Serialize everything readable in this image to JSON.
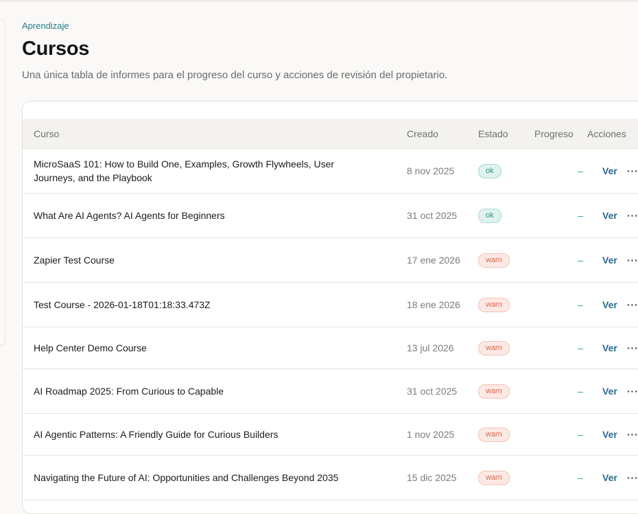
{
  "breadcrumb": "Aprendizaje",
  "page": {
    "title": "Cursos",
    "subtitle": "Una única tabla de informes para el progreso del curso y acciones de revisión del propietario."
  },
  "table": {
    "headers": {
      "curso": "Curso",
      "creado": "Creado",
      "estado": "Estado",
      "progreso": "Progreso",
      "acciones": "Acciones"
    },
    "rows": [
      {
        "title": "MicroSaaS 101: How to Build One, Examples, Growth Flywheels, User Journeys, and the Playbook",
        "created": "8 nov 2025",
        "status": "ok",
        "progress": "–",
        "action": "Ver",
        "more": "···"
      },
      {
        "title": "What Are AI Agents? AI Agents for Beginners",
        "created": "31 oct 2025",
        "status": "ok",
        "progress": "–",
        "action": "Ver",
        "more": "···"
      },
      {
        "title": "Zapier Test Course",
        "created": "17 ene 2026",
        "status": "warn",
        "progress": "–",
        "action": "Ver",
        "more": "···"
      },
      {
        "title": "Test Course - 2026-01-18T01:18:33.473Z",
        "created": "18 ene 2026",
        "status": "warn",
        "progress": "–",
        "action": "Ver",
        "more": "···"
      },
      {
        "title": "Help Center Demo Course",
        "created": "13 jul 2026",
        "status": "warn",
        "progress": "–",
        "action": "Ver",
        "more": "···"
      },
      {
        "title": "AI Roadmap 2025: From Curious to Capable",
        "created": "31 oct 2025",
        "status": "warn",
        "progress": "–",
        "action": "Ver",
        "more": "···"
      },
      {
        "title": "AI Agentic Patterns: A Friendly Guide for Curious Builders",
        "created": "1 nov 2025",
        "status": "warn",
        "progress": "–",
        "action": "Ver",
        "more": "···"
      },
      {
        "title": "Navigating the Future of AI: Opportunities and Challenges Beyond 2035",
        "created": "15 dic 2025",
        "status": "warn",
        "progress": "–",
        "action": "Ver",
        "more": "···"
      }
    ]
  },
  "colors": {
    "accent": "#2a6b8c",
    "ok_badge": "#dff2ef",
    "warn_badge": "#fde9e4"
  }
}
